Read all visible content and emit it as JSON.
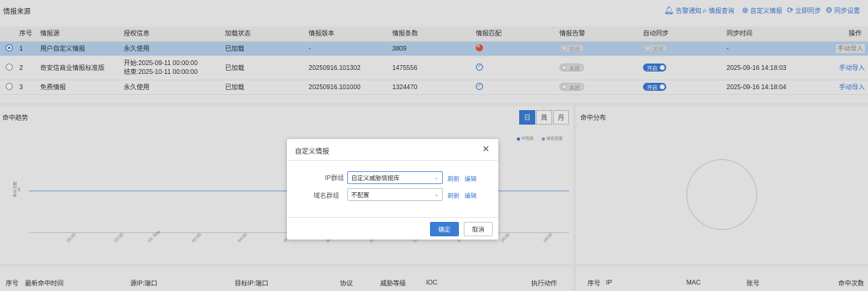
{
  "source_panel": {
    "title": "情报来源",
    "toolbar": [
      {
        "icon": "bell-icon",
        "glyph": "🔔︎",
        "label": "告警通知"
      },
      {
        "icon": "search-icon",
        "glyph": "⌕",
        "label": "情报查询"
      },
      {
        "icon": "plus-circle-icon",
        "glyph": "⊕",
        "label": "自定义情报"
      },
      {
        "icon": "sync-icon",
        "glyph": "⟳",
        "label": "立即同步"
      },
      {
        "icon": "gear-icon",
        "glyph": "⚙",
        "label": "同步设置"
      }
    ],
    "columns": [
      "序号",
      "情报源",
      "授权信息",
      "加载状态",
      "情报版本",
      "情报条数",
      "情报匹配",
      "情报告警",
      "自动同步",
      "同步时间",
      "操作"
    ],
    "rows": [
      {
        "no": "1",
        "source": "用户自定义情报",
        "auth": "永久使用",
        "auth2": "",
        "load": "已加载",
        "version": "-",
        "count": "3809",
        "match": "error",
        "alert": "关闭",
        "sync": "关闭",
        "sync_on": false,
        "time": "-",
        "action": "手动导入",
        "selected": true
      },
      {
        "no": "2",
        "source": "奇安信商业情报标准版",
        "auth": "开始:2025-09-11 00:00:00",
        "auth2": "结束:2025-10-11 00:00:00",
        "load": "已加载",
        "version": "20250916.101302",
        "count": "1475556",
        "match": "ok",
        "alert": "关闭",
        "sync": "开启",
        "sync_on": true,
        "time": "2025-09-16 14:18:03",
        "action": "手动导入",
        "selected": false
      },
      {
        "no": "3",
        "source": "免费情报",
        "auth": "永久使用",
        "auth2": "",
        "load": "已加载",
        "version": "20250916.101000",
        "count": "1324470",
        "match": "ok",
        "alert": "关闭",
        "sync": "开启",
        "sync_on": true,
        "time": "2025-09-16 14:18:04",
        "action": "手动导入",
        "selected": false
      }
    ]
  },
  "trend_panel": {
    "title": "命中趋势",
    "segments": [
      "日",
      "周",
      "月"
    ],
    "active_segment": "日",
    "legend": [
      {
        "label": "IP情报",
        "color": "#3a7bd5"
      },
      {
        "label": "域名情报",
        "color": "#7aa6e0"
      }
    ],
    "y_axis_label": "命中次数",
    "y_tick": "0",
    "x_ticks": [
      "20:00",
      "22:00",
      "16. Sep",
      "02:00",
      "04:00",
      "06:00",
      "08:00",
      "10:00",
      "12:00",
      "14:00",
      "16:00",
      "18:00"
    ]
  },
  "dist_panel": {
    "title": "命中分布"
  },
  "bottom_left_columns": [
    "序号",
    "最新命中时间",
    "源IP:端口",
    "目标IP:端口",
    "协议",
    "威胁等级",
    "IOC",
    "执行动作"
  ],
  "bottom_right_columns": [
    "序号",
    "IP",
    "MAC",
    "账号",
    "命中次数"
  ],
  "modal": {
    "title": "自定义情报",
    "close_glyph": "✕",
    "fields": [
      {
        "label": "IP群组",
        "value": "自定义威胁情报库",
        "refresh": "刷新",
        "edit": "编辑"
      },
      {
        "label": "域名群组",
        "value": "不配置",
        "refresh": "刷新",
        "edit": "编辑"
      }
    ],
    "ok": "确定",
    "cancel": "取消"
  },
  "colors": {
    "accent": "#3a7bd5",
    "success": "#2ea043",
    "error": "#e8553a",
    "selected_row": "#b8d2ee"
  }
}
